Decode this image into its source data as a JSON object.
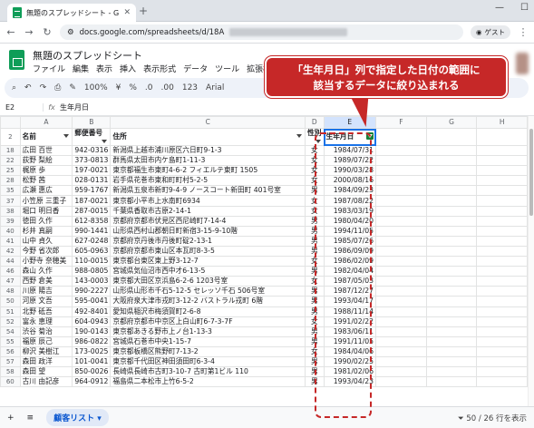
{
  "browser": {
    "tab_title": "無題のスプレッドシート - Google スプ",
    "url_prefix": "docs.google.com/spreadsheets/d/18A",
    "guest": "ゲスト"
  },
  "app": {
    "title": "無題のスプレッドシート",
    "menus": [
      "ファイル",
      "編集",
      "表示",
      "挿入",
      "表示形式",
      "データ",
      "ツール",
      "拡張機能"
    ]
  },
  "toolbar": {
    "zoom": "100%",
    "currency": "¥",
    "percent": "%",
    "dec1": ".0",
    "dec2": ".00",
    "num": "123",
    "font": "Arial"
  },
  "formula": {
    "cell": "E2",
    "value": "生年月日"
  },
  "columns": [
    "A",
    "B",
    "C",
    "D",
    "E",
    "F",
    "G",
    "H"
  ],
  "header_row": {
    "num": "2",
    "name": "名前",
    "zip": "郵便番号",
    "addr": "住所",
    "sex": "性別",
    "birth": "生年月日"
  },
  "rows": [
    [
      "18",
      "広田 百世",
      "942-0316",
      "新潟県上越市浦川原区六日町9-1-3",
      "女",
      "1984/07/31"
    ],
    [
      "22",
      "荻野 梨絵",
      "373-0813",
      "群馬県太田市内ケ島町1-11-3",
      "女",
      "1989/07/22"
    ],
    [
      "25",
      "梶原 歩",
      "197-0021",
      "東京都福生市東町4-6-2 フィエルテ東町 1505",
      "女",
      "1990/03/28"
    ],
    [
      "28",
      "松野 茜",
      "028-0131",
      "岩手県花巻市東和町町村5-2-5",
      "女",
      "2000/08/16"
    ],
    [
      "35",
      "広瀬 惠広",
      "959-1767",
      "新潟県五泉市新町9-4-9 ノースコート新田町 401号室",
      "男",
      "1984/09/23"
    ],
    [
      "37",
      "小笠原 三重子",
      "187-0021",
      "東京都小平市上水南町6934",
      "女",
      "1987/08/22"
    ],
    [
      "38",
      "堀口 明日香",
      "287-0015",
      "千葉県香取市古原2-14-1",
      "女",
      "1983/03/19"
    ],
    [
      "39",
      "徳田 久作",
      "612-8358",
      "京都府京都市伏見区西尼崎町7-14-4",
      "男",
      "1980/04/20"
    ],
    [
      "40",
      "杉井 真嗣",
      "990-1441",
      "山形県西村山郡朝日町新宿3-15-9-10階",
      "男",
      "1994/11/05"
    ],
    [
      "41",
      "山中 貞久",
      "627-0248",
      "京都府京丹後市丹後町碇2-13-1",
      "男",
      "1985/07/26"
    ],
    [
      "42",
      "今野 省次郎",
      "605-0963",
      "京都府京都市東山区本瓦町8-3-5",
      "男",
      "1986/09/09"
    ],
    [
      "44",
      "小野寺 奈穂美",
      "110-0015",
      "東京都台東区東上野3-12-7",
      "女",
      "1986/02/09"
    ],
    [
      "46",
      "森山 久作",
      "988-0805",
      "宮城県気仙沼市西中才6-13-5",
      "男",
      "1982/04/04"
    ],
    [
      "47",
      "西野 倉美",
      "143-0003",
      "東京都大田区京浜島6-2-6 1203号室",
      "女",
      "1987/05/03"
    ],
    [
      "48",
      "川原 陽吉",
      "990-2227",
      "山形県山形市千石5-12-5 セレッソ千石 506号室",
      "男",
      "1987/12/27"
    ],
    [
      "50",
      "河原 文吾",
      "595-0041",
      "大阪府泉大津市戎町3-12-2 バストラル戎町 6階",
      "男",
      "1993/04/17"
    ],
    [
      "51",
      "北野 砥吾",
      "492-8401",
      "愛知県稲沢市梅須賀町2-6-8",
      "男",
      "1988/11/14"
    ],
    [
      "52",
      "富永 恵理",
      "604-0943",
      "京都府京都市中京区上白山町6-7-3-7F",
      "女",
      "1991/02/22"
    ],
    [
      "54",
      "渋谷 菊治",
      "190-0143",
      "東京都あきる野市上ノ台1-13-3",
      "男",
      "1983/06/11"
    ],
    [
      "55",
      "福原 辰己",
      "986-0822",
      "宮城県石巻市中央1-15-7",
      "男",
      "1991/11/05"
    ],
    [
      "56",
      "柳沢 美樹江",
      "173-0025",
      "東京都板橋区熊野町7-13-2",
      "女",
      "1984/04/06"
    ],
    [
      "57",
      "森田 政洋",
      "101-0041",
      "東京都千代田区神田須田町6-3-4",
      "男",
      "1990/02/25"
    ],
    [
      "58",
      "森田 望",
      "850-0026",
      "長崎県長崎市古町3-10-7 古町第1ビル 110",
      "男",
      "1981/02/06"
    ],
    [
      "60",
      "古川 由記彦",
      "964-0912",
      "福島県二本松市上竹6-5-2",
      "男",
      "1993/04/23"
    ]
  ],
  "sheet": {
    "name": "顧客リスト",
    "status": "50 / 26 行を表示"
  },
  "callout": {
    "line1": "「生年月日」列で指定した日付の範囲に",
    "line2": "該当するデータに絞り込まれる"
  }
}
